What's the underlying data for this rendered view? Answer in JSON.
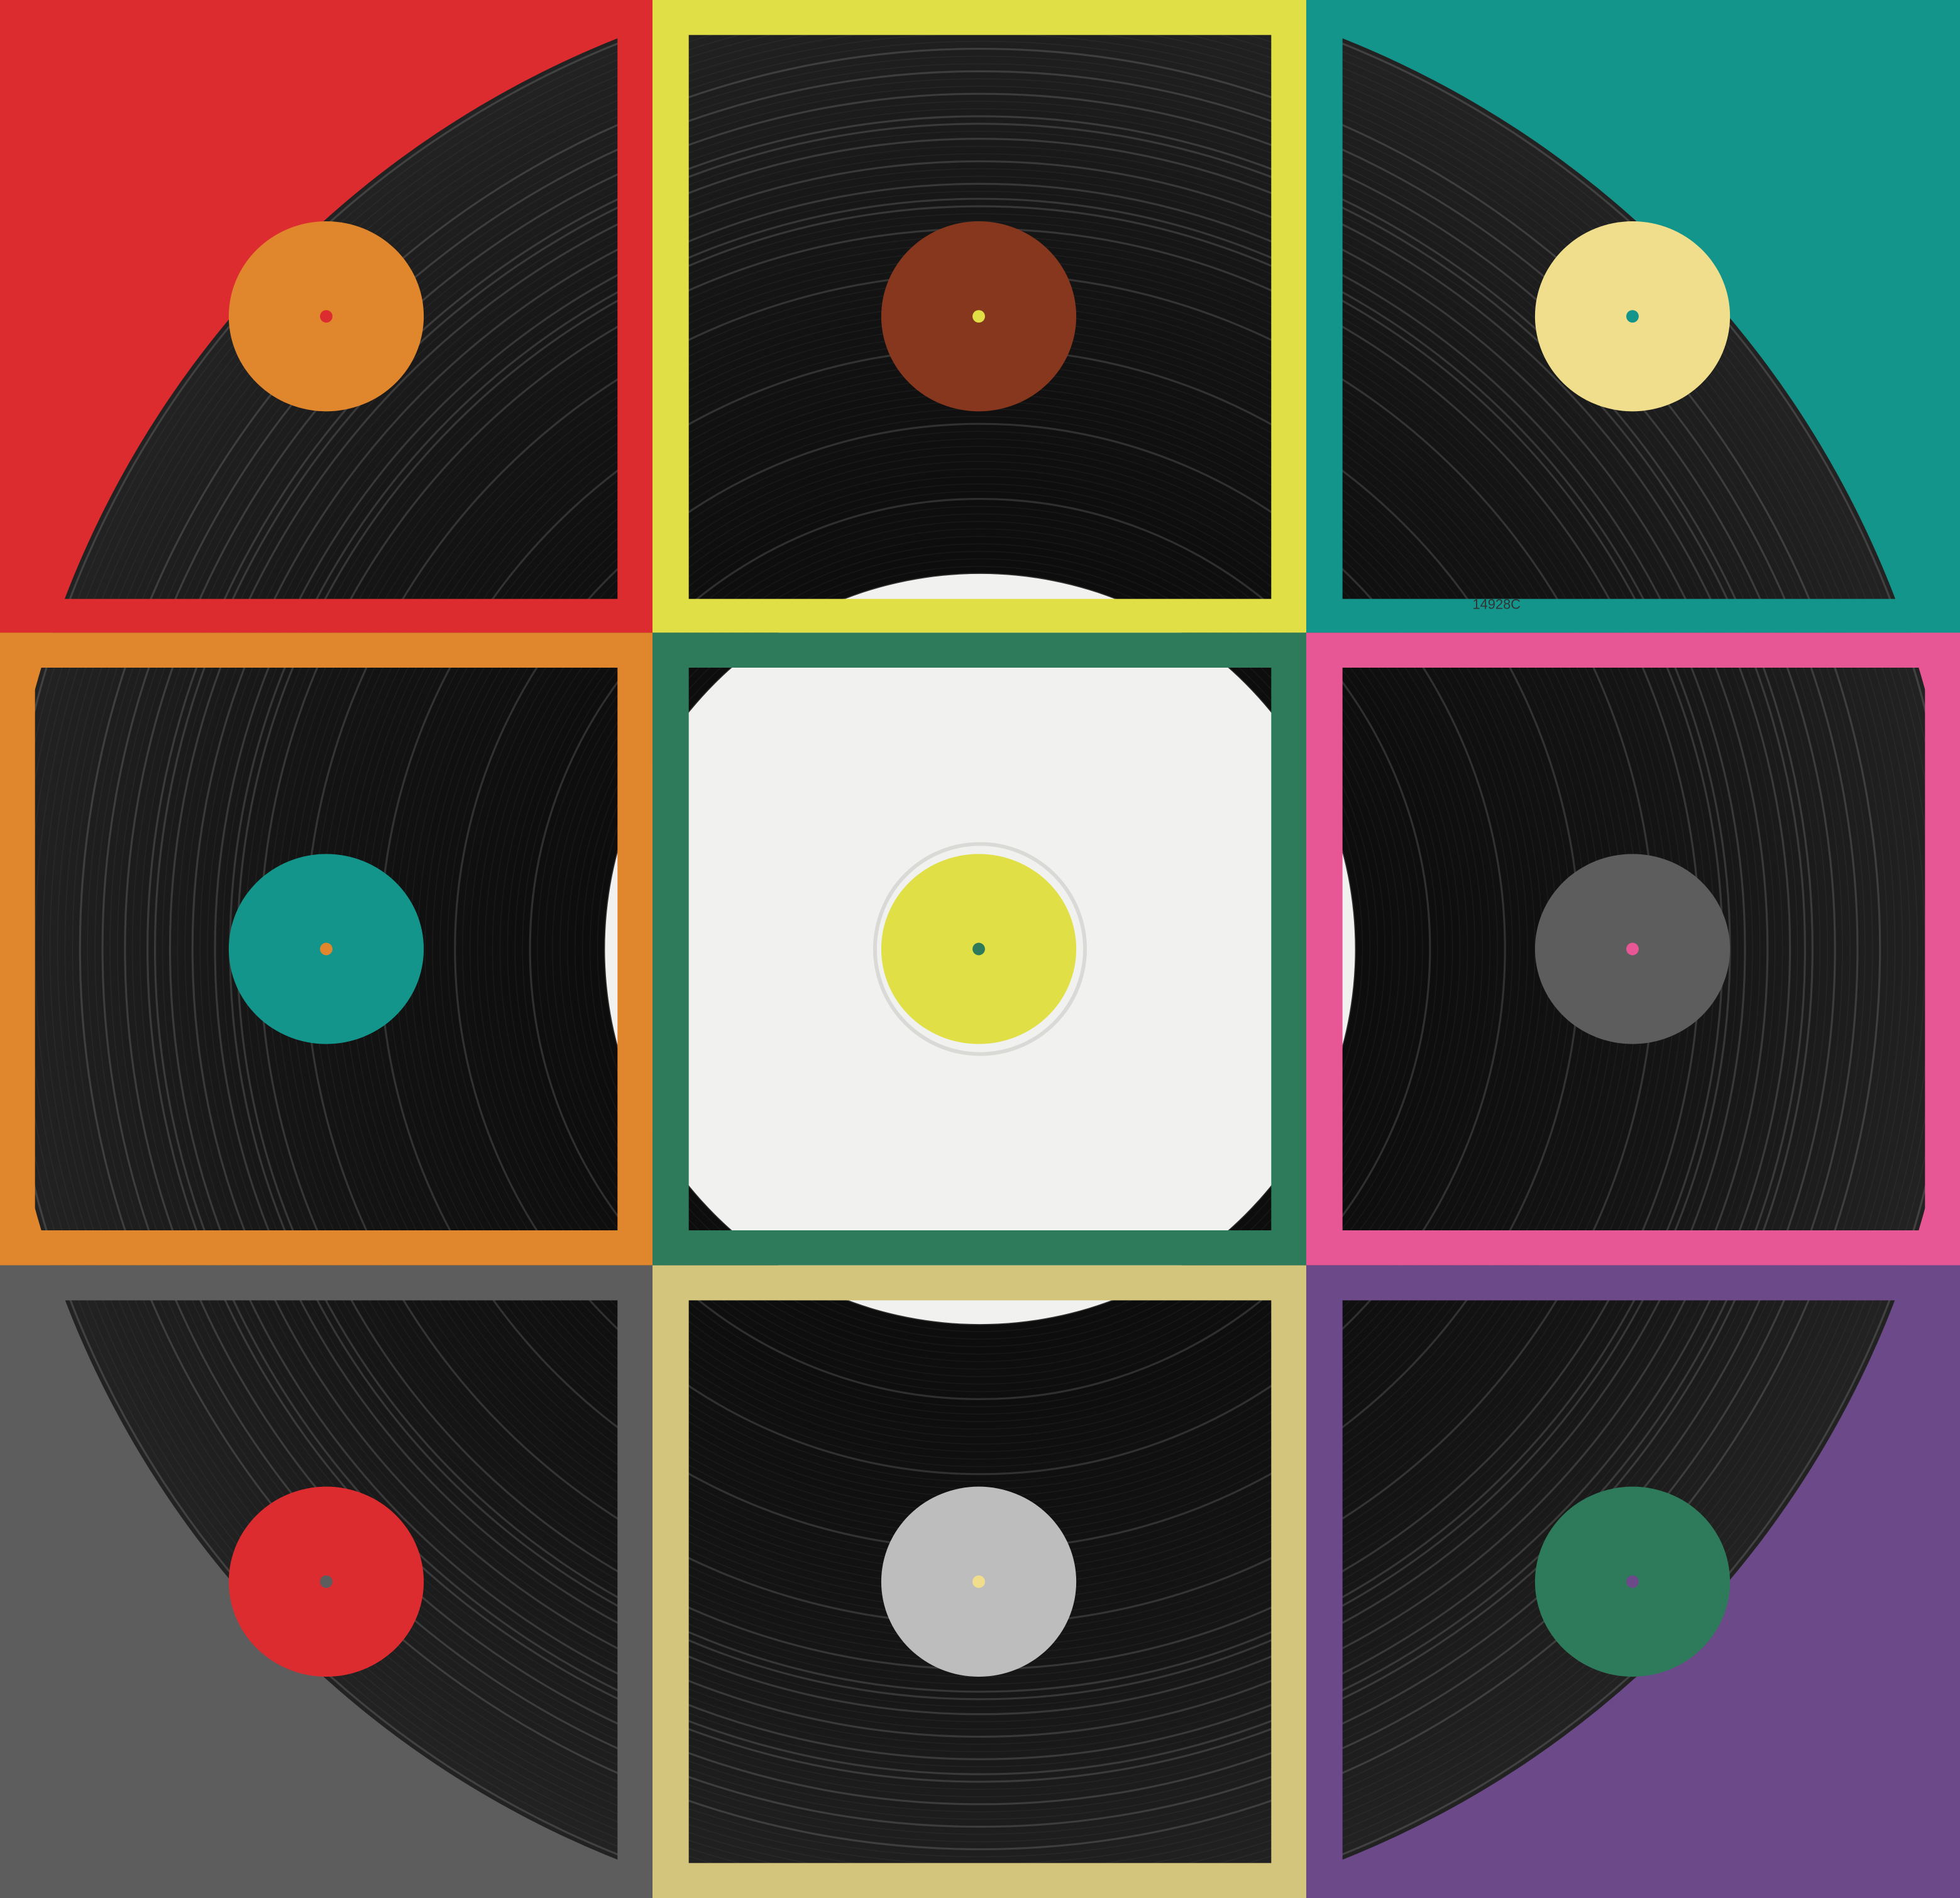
{
  "artwork": {
    "record_colors": {
      "vinyl_black": "#0a0a0a",
      "groove_dark": "#151515",
      "groove_highlight": "#3a3a3a",
      "white_label": "#f1f1ef"
    },
    "catalog_code": "14928C",
    "tiles": [
      {
        "name": "tile-top-left",
        "frame": "#dc2c2f",
        "label": "#e0862c",
        "spindle": "#dc2c2f"
      },
      {
        "name": "tile-top-center",
        "frame": "#e0e046",
        "label": "#86371e",
        "spindle": "#e0e046"
      },
      {
        "name": "tile-top-right",
        "frame": "#14958b",
        "label": "#f0de8c",
        "spindle": "#14958b"
      },
      {
        "name": "tile-middle-left",
        "frame": "#e0862c",
        "label": "#14958b",
        "spindle": "#e0862c"
      },
      {
        "name": "tile-center",
        "frame": "#2d7b5a",
        "label": "#e0e046",
        "spindle": "#2d7b5a"
      },
      {
        "name": "tile-middle-right",
        "frame": "#e85795",
        "label": "#5d5d5d",
        "spindle": "#e85795"
      },
      {
        "name": "tile-bottom-left",
        "frame": "#5d5d5d",
        "label": "#dc2c2f",
        "spindle": "#5d5d5d"
      },
      {
        "name": "tile-bottom-center",
        "frame": "#d4c57c",
        "label": "#bdbdbd",
        "spindle": "#f0de8c"
      },
      {
        "name": "tile-bottom-right",
        "frame": "#6c4a8a",
        "label": "#2d7b5a",
        "spindle": "#6c4a8a"
      }
    ]
  }
}
